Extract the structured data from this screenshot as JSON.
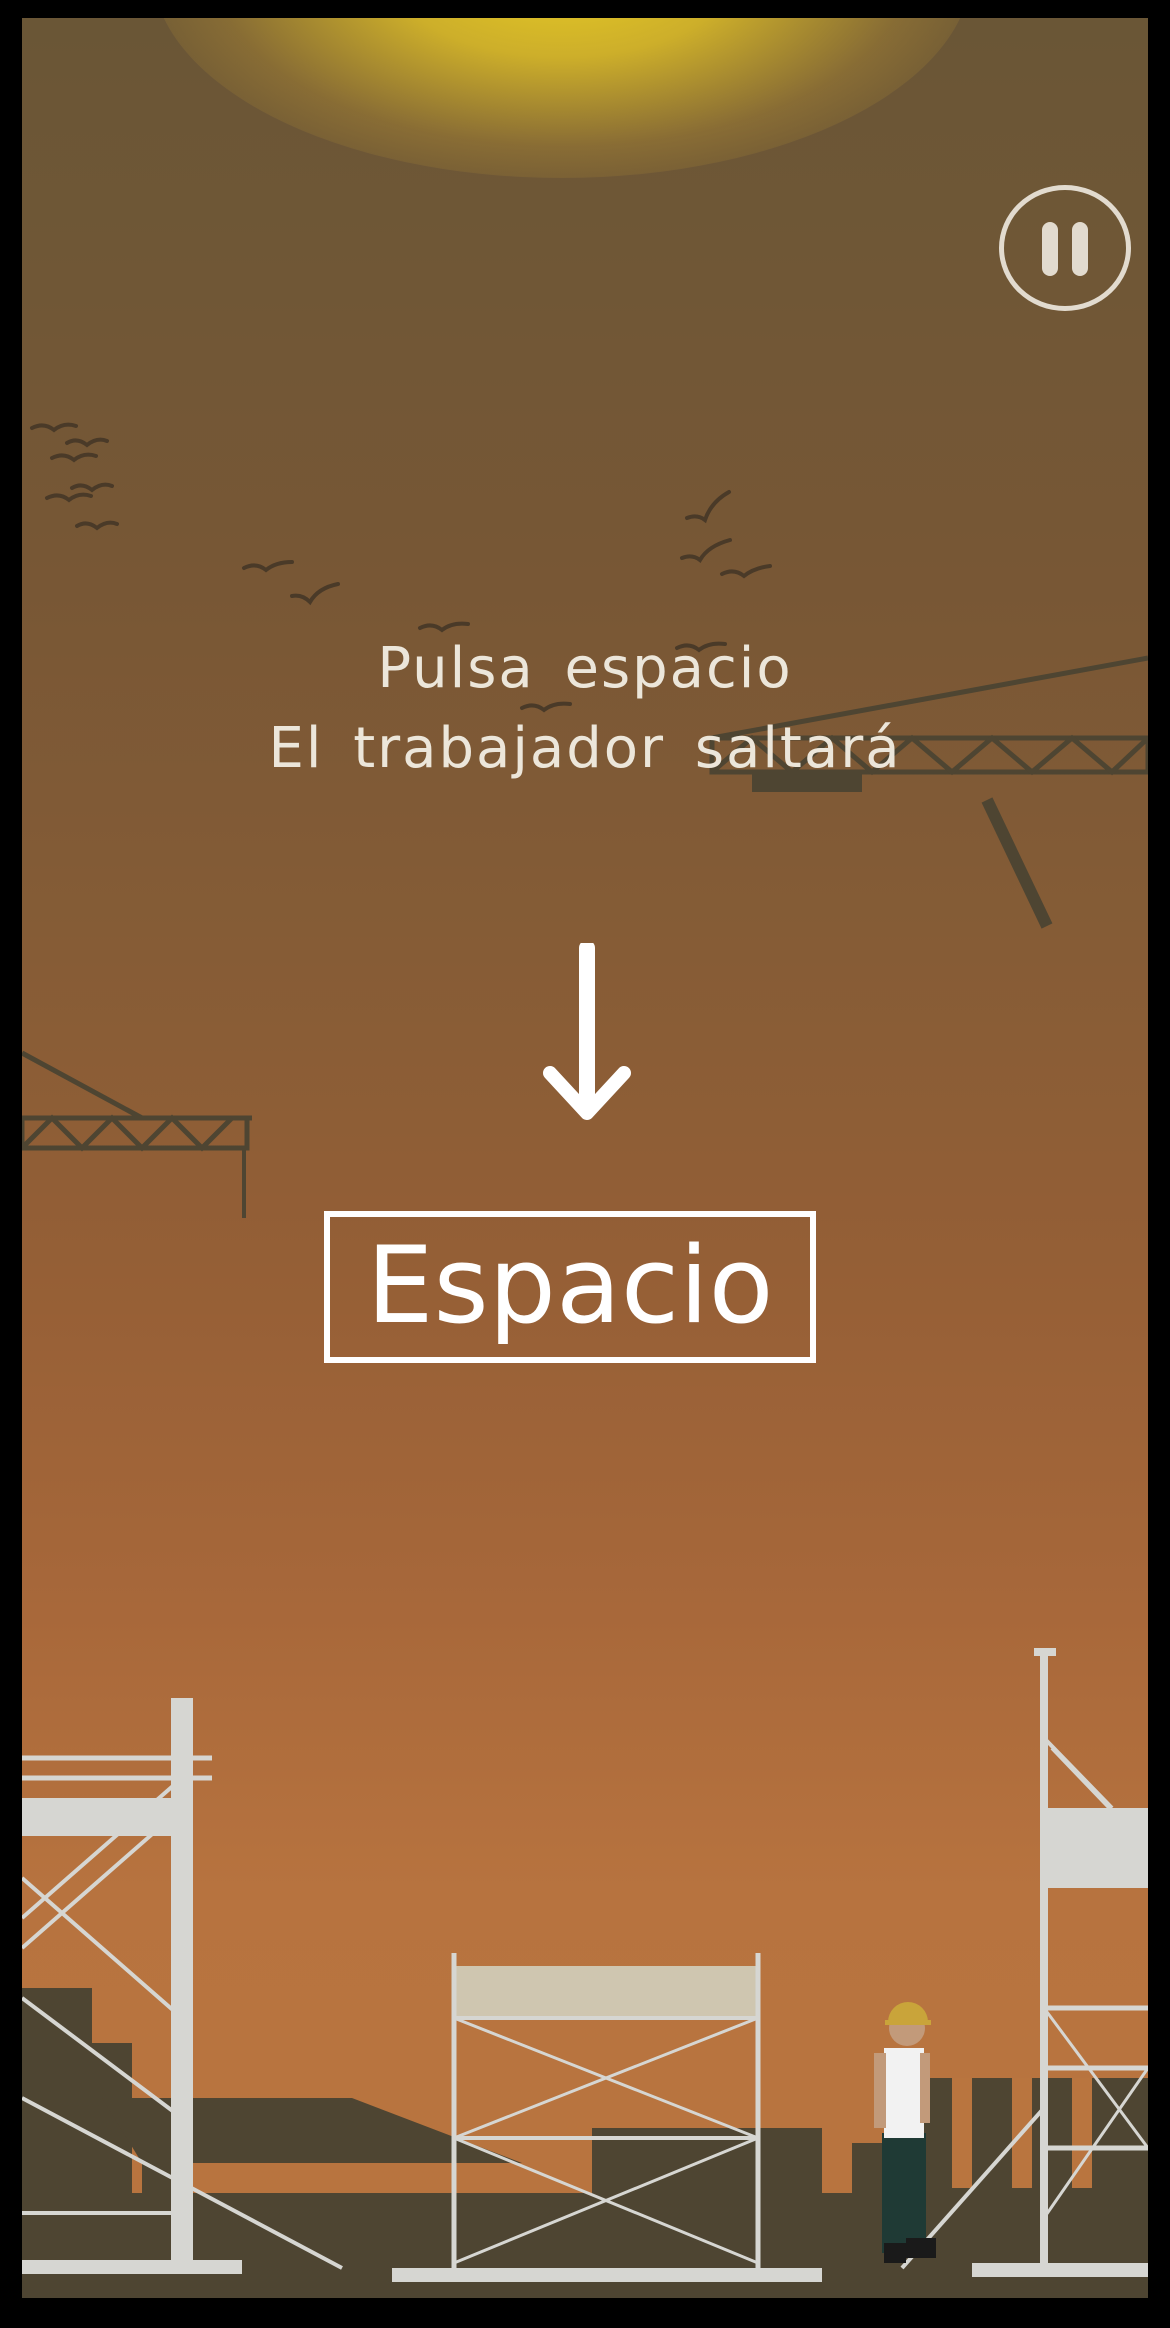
{
  "instructions": {
    "line1": "Pulsa espacio",
    "line2": "El trabajador saltará"
  },
  "key_prompt": {
    "label": "Espacio",
    "arrow_icon": "down-arrow-icon"
  },
  "pause": {
    "icon": "pause-icon"
  },
  "colors": {
    "sky_top": "#6a5636",
    "sky_bottom": "#b9753f",
    "sun": "#e8cc24",
    "text": "#ece6da",
    "scaffold": "#d6d6d2",
    "silhouette": "#4e4532",
    "worker_shirt": "#f2f2f2",
    "worker_pants": "#1f3a35",
    "helmet": "#c9a43a"
  }
}
